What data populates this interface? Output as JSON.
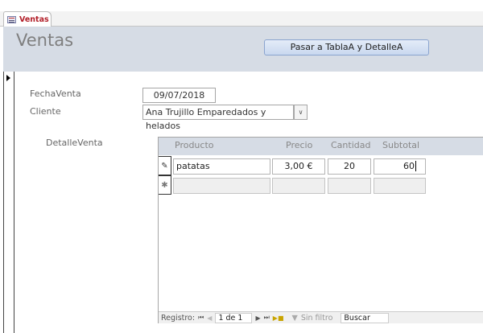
{
  "tab": {
    "label": "Ventas"
  },
  "header": {
    "title": "Ventas",
    "button_label": "Pasar a TablaA y DetalleA"
  },
  "form": {
    "fecha_label": "FechaVenta",
    "fecha_value": "09/07/2018",
    "cliente_label": "Cliente",
    "cliente_value": "Ana Trujillo Emparedados y helados",
    "detalle_label": "DetalleVenta"
  },
  "subform": {
    "columns": [
      "Producto",
      "Precio",
      "Cantidad",
      "Subtotal"
    ],
    "rows": [
      {
        "producto": "patatas",
        "precio": "3,00 €",
        "cantidad": "20",
        "subtotal": "60"
      }
    ],
    "edit_icon": "pencil-icon",
    "new_icon": "asterisk-icon"
  },
  "nav": {
    "registro_label": "Registro:",
    "position": "1 de 1",
    "filter_label": "Sin filtro",
    "search_placeholder": "Buscar"
  }
}
